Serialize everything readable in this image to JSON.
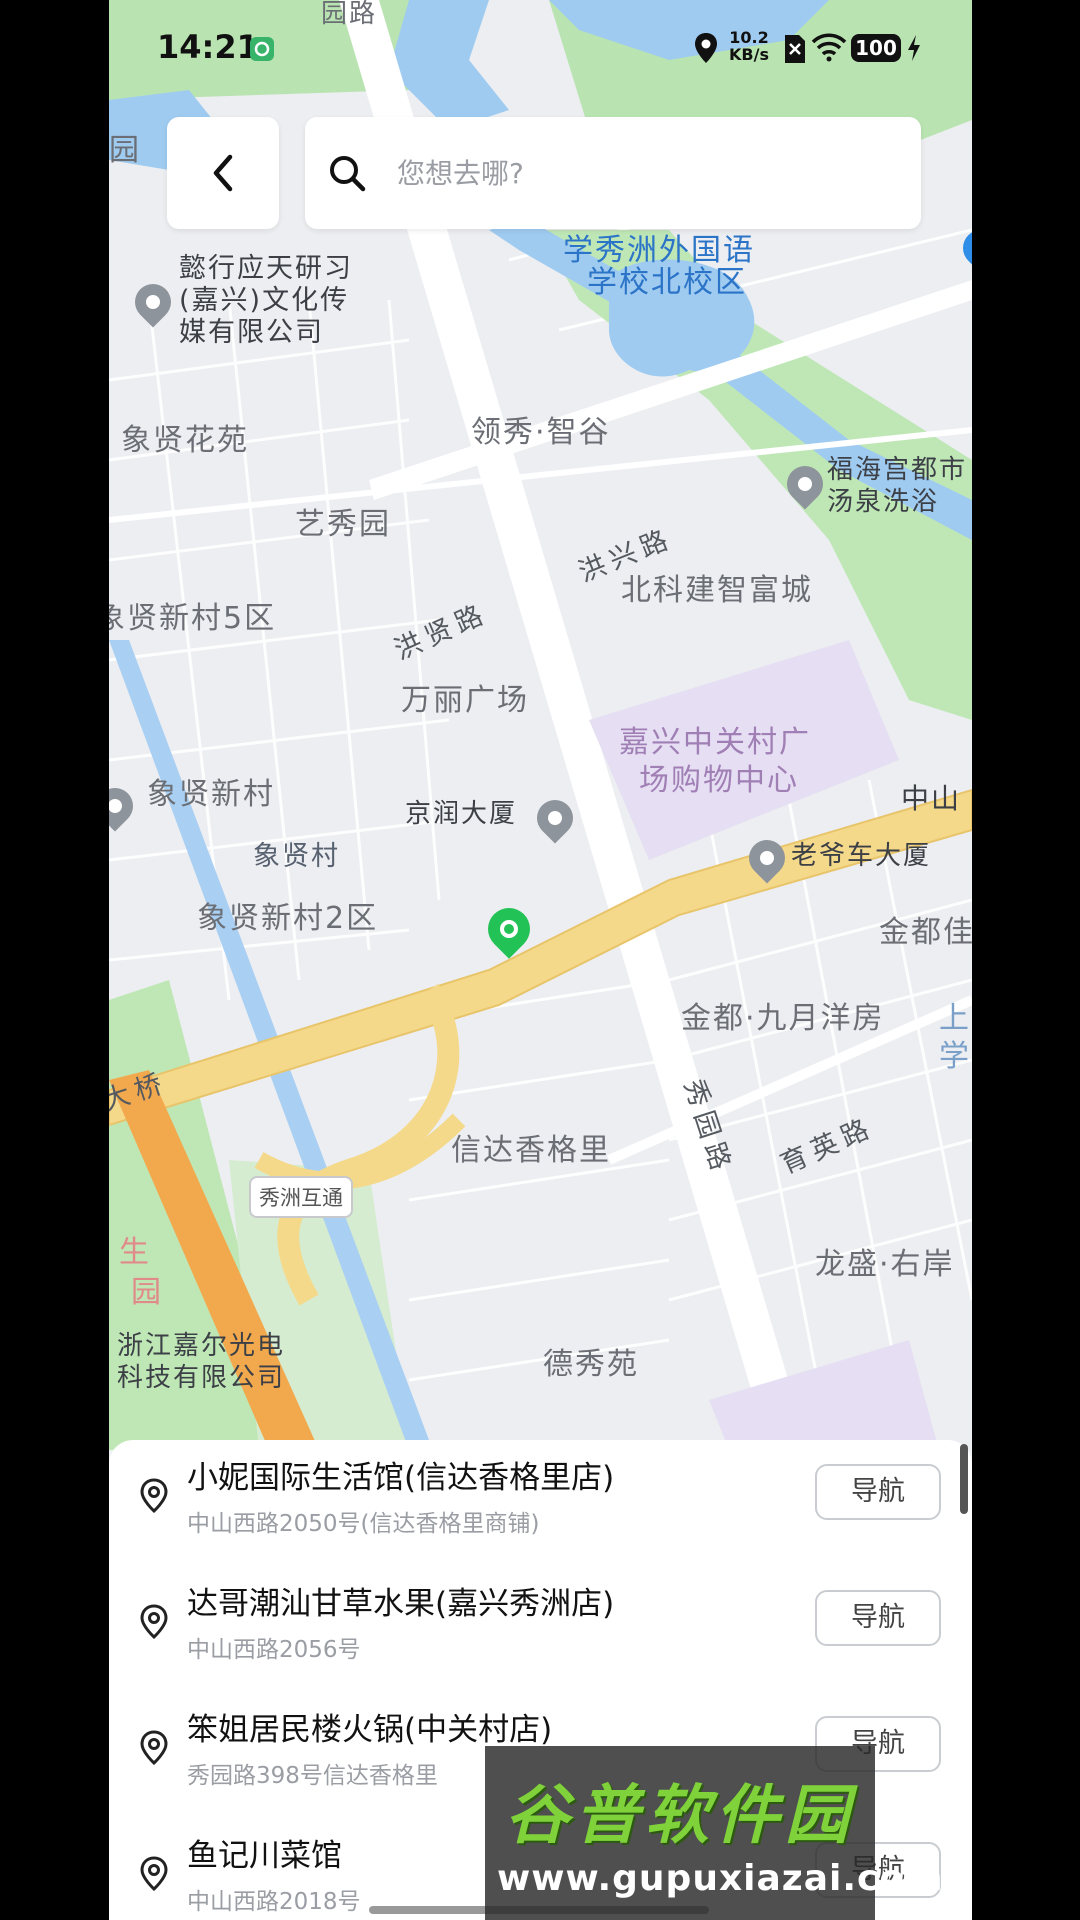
{
  "status_bar": {
    "time": "14:21",
    "net_speed_value": "10.2",
    "net_speed_unit": "KB/s",
    "battery": "100"
  },
  "search": {
    "placeholder": "您想去哪?"
  },
  "map": {
    "labels": {
      "yuan_road": "园路",
      "hao_yuan": "园",
      "school": "学秀洲外国语",
      "school2": "学校北校区",
      "media": "懿行应天研习",
      "media2": "(嘉兴)文化传",
      "media3": "媒有限公司",
      "xiangxian_huayuan": "象贤花苑",
      "lingxiu": "领秀·智谷",
      "fuhai": "福海宫都市",
      "fuhai2": "汤泉洗浴",
      "yixiu": "艺秀园",
      "hongxing_road": "洪兴路",
      "hongxian_road": "洪贤路",
      "beike": "北科建智富城",
      "xiangxian5": "象贤新村5区",
      "wanli": "万丽广场",
      "zhongguancun": "嘉兴中关村广",
      "zhongguancun2": "场购物中心",
      "xiangxian_xincun": "象贤新村",
      "jingrun": "京润大厦",
      "zhongshan": "中山",
      "laoyeche": "老爷车大厦",
      "xiangxian_cun": "象贤村",
      "xiangxian2": "象贤新村2区",
      "jindu": "金都佳",
      "jindu_jiuyue": "金都·九月洋房",
      "shang": "上",
      "xue": "学",
      "daqiao": "大桥",
      "xiuyuan_road": "秀园路",
      "yuying_road": "育英路",
      "xinda": "信达香格里",
      "xiuzhou_hutong": "秀洲互通",
      "longsheng": "龙盛·右岸",
      "sheng": "生",
      "yuan2": "园",
      "jiaer": "浙江嘉尔光电",
      "jiaer2": "科技有限公司",
      "dexiu": "德秀苑"
    }
  },
  "results": [
    {
      "name": "小妮国际生活馆(信达香格里店)",
      "address": "中山西路2050号(信达香格里商铺)",
      "nav": "导航"
    },
    {
      "name": "达哥潮汕甘草水果(嘉兴秀洲店)",
      "address": "中山西路2056号",
      "nav": "导航"
    },
    {
      "name": "笨姐居民楼火锅(中关村店)",
      "address": "秀园路398号信达香格里",
      "nav": "导航"
    },
    {
      "name": "鱼记川菜馆",
      "address": "中山西路2018号",
      "nav": "导航"
    }
  ],
  "watermark": {
    "title": "谷普软件园",
    "url": "www.gupuxiazai.com"
  }
}
